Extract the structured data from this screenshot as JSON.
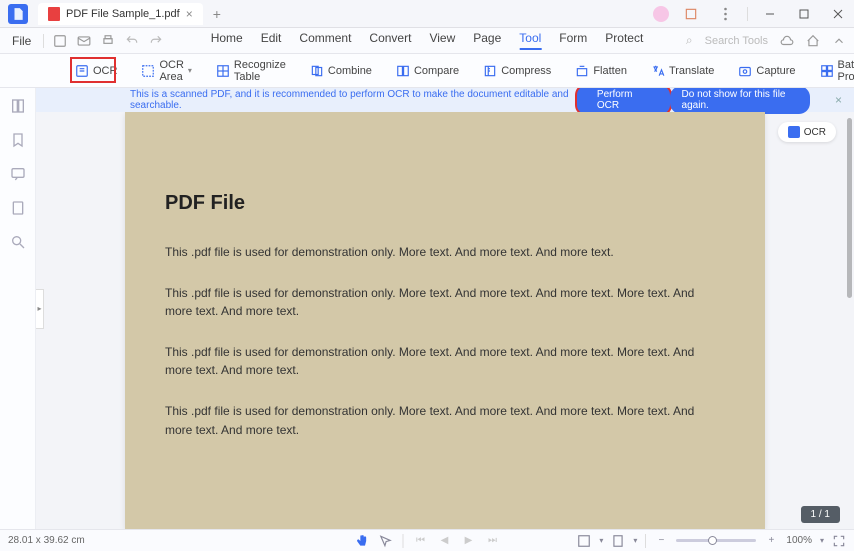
{
  "titlebar": {
    "tab_title": "PDF File Sample_1.pdf",
    "tab_close": "×",
    "add_tab": "+"
  },
  "menurow": {
    "file": "File",
    "items": [
      "Home",
      "Edit",
      "Comment",
      "Convert",
      "View",
      "Page",
      "Tool",
      "Form",
      "Protect"
    ],
    "active": "Tool",
    "search_placeholder": "Search Tools"
  },
  "toolbar": {
    "ocr": "OCR",
    "ocr_area": "OCR Area",
    "recognize_table": "Recognize Table",
    "combine": "Combine",
    "compare": "Compare",
    "compress": "Compress",
    "flatten": "Flatten",
    "translate": "Translate",
    "capture": "Capture",
    "batch_process": "Batch Process"
  },
  "banner": {
    "message": "This is a scanned PDF, and it is recommended to perform OCR to make the document editable and searchable.",
    "perform": "Perform OCR",
    "dismiss": "Do not show for this file again.",
    "close": "×"
  },
  "ocr_pill": {
    "label": "OCR"
  },
  "document": {
    "title": "PDF File",
    "p1": "This .pdf file is used for demonstration only. More text. And more text. And more text.",
    "p2": "This .pdf file is used for demonstration only. More text. And more text. And more text. More text. And more text. And more text.",
    "p3": "This .pdf file is used for demonstration only. More text. And more text. And more text. More text. And more text. And more text.",
    "p4": "This .pdf file is used for demonstration only. More text. And more text. And more text. More text. And more text. And more text."
  },
  "page_indicator": "1 / 1",
  "statusbar": {
    "dimensions": "28.01 x 39.62 cm",
    "zoom": "100%"
  }
}
